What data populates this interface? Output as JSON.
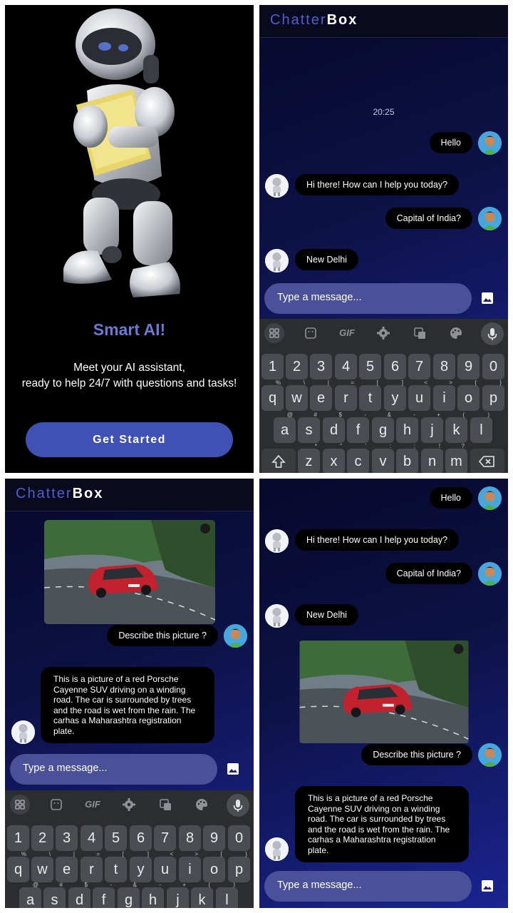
{
  "welcome": {
    "title": "Smart AI!",
    "description_line1": "Meet your AI assistant,",
    "description_line2": "ready to help 24/7 with questions and tasks!",
    "button": "Get Started"
  },
  "app": {
    "brand_part1": "Chatter",
    "brand_part2": "Box"
  },
  "chat": {
    "time": "20:25",
    "msg_hello": "Hello",
    "msg_greeting": "Hi there! How can I help you today?",
    "msg_question": "Capital of India?",
    "msg_answer": "New Delhi",
    "msg_image_prompt": "Describe this picture ?",
    "msg_image_reply": "This is a picture of a red Porsche Cayenne SUV driving on a winding road. The car is surrounded by trees and the road is wet from the rain. The carhas a Maharashtra registration plate.",
    "input_placeholder": "Type a message..."
  },
  "keyboard": {
    "toolbar": [
      "apps-icon",
      "sticker-icon",
      "GIF",
      "gear-icon",
      "translate-icon",
      "palette-icon",
      "mic-icon"
    ],
    "row_numbers": [
      "1",
      "2",
      "3",
      "4",
      "5",
      "6",
      "7",
      "8",
      "9",
      "0"
    ],
    "row_q": [
      "q",
      "w",
      "e",
      "r",
      "t",
      "y",
      "u",
      "i",
      "o",
      "p"
    ],
    "row_q_sup": [
      "%",
      "\\",
      "|",
      "=",
      "[",
      "]",
      "<",
      ">",
      "{",
      "}"
    ],
    "row_a": [
      "a",
      "s",
      "d",
      "f",
      "g",
      "h",
      "j",
      "k",
      "l"
    ],
    "row_a_sup": [
      "@",
      "#",
      "$",
      "-",
      "&",
      "-",
      "+",
      "(",
      ")"
    ],
    "row_z": [
      "z",
      "x",
      "c",
      "v",
      "b",
      "n",
      "m"
    ],
    "row_z_sup": [
      "*",
      "\"",
      "'",
      ":",
      ";",
      "!",
      "?"
    ]
  },
  "colors": {
    "accent": "#3f51b5",
    "brand_accent": "#4f5fd0",
    "bubble": "#000000",
    "input_bg": "#4a5199"
  }
}
